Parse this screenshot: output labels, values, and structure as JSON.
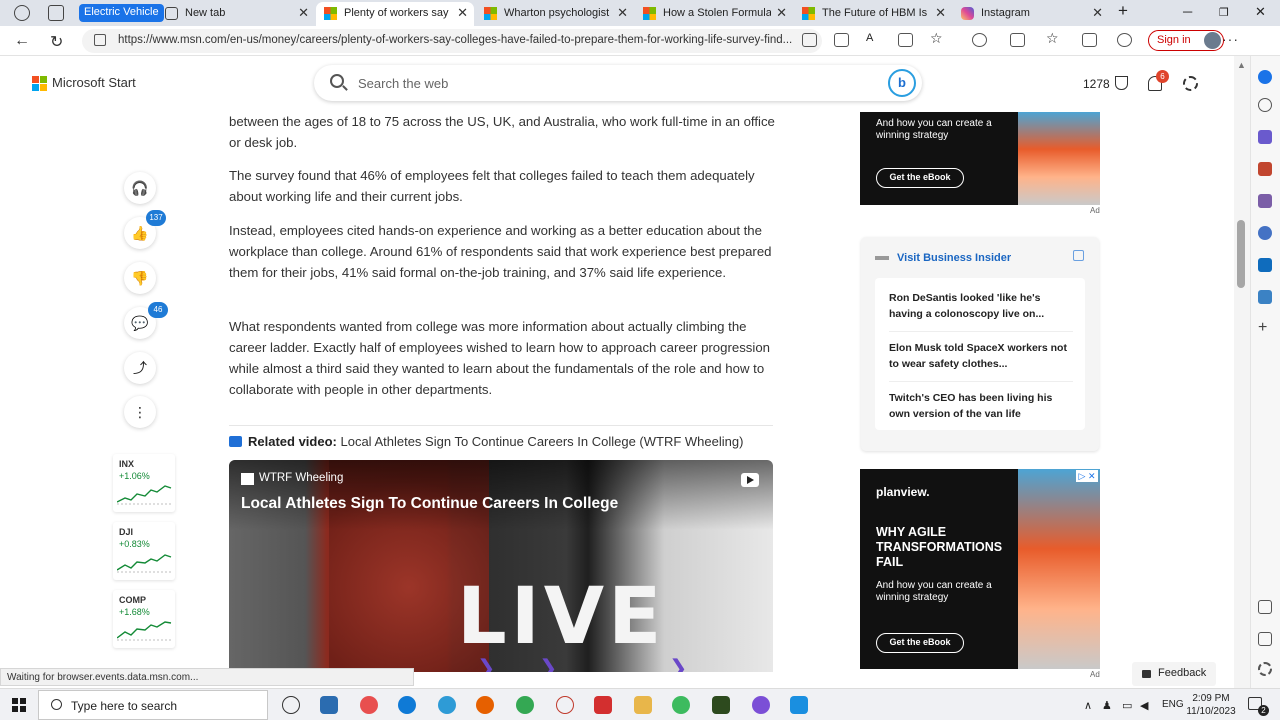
{
  "browser": {
    "tab_group_label": "Electric Vehicle",
    "tabs": [
      {
        "title": "New tab",
        "favicon": "newtab",
        "active": false
      },
      {
        "title": "Plenty of workers say coll",
        "favicon": "msn",
        "active": true
      },
      {
        "title": "Wharton psychologist on",
        "favicon": "msn",
        "active": false
      },
      {
        "title": "How a Stolen Formula Le",
        "favicon": "msn",
        "active": false
      },
      {
        "title": "The Future of HBM Is Lig",
        "favicon": "msn",
        "active": false
      },
      {
        "title": "Instagram",
        "favicon": "instagram",
        "active": false
      }
    ],
    "new_tab_symbol": "+",
    "url": "https://www.msn.com/en-us/money/careers/plenty-of-workers-say-colleges-have-failed-to-prepare-them-for-working-life-survey-find...",
    "sign_in_label": "Sign in",
    "status_text": "Waiting for browser.events.data.msn.com..."
  },
  "msn": {
    "brand": "Microsoft Start",
    "search_placeholder": "Search the web",
    "points": "1278",
    "notification_count": "6"
  },
  "engagement": {
    "like_count": "137",
    "comment_count": "46"
  },
  "stocks": [
    {
      "symbol": "INX",
      "change": "+1.06%"
    },
    {
      "symbol": "DJI",
      "change": "+0.83%"
    },
    {
      "symbol": "COMP",
      "change": "+1.68%"
    }
  ],
  "article": {
    "paragraphs": [
      "between the ages of 18 to 75 across the US, UK, and Australia, who work full-time in an office or desk job.",
      "The survey found that 46% of employees felt that colleges failed to teach them adequately about working life and their current jobs.",
      "Instead, employees cited hands-on experience and working as a better education about the workplace than college. Around 61% of respondents said that work experience best prepared them for their jobs, 41% said formal on-the-job training, and 37% said life experience.",
      "What respondents wanted from college was more information about actually climbing the career ladder. Exactly half of employees wished to learn how to approach career progression while almost a third said they wanted to learn about the fundamentals of the role and how to collaborate with people in other departments."
    ],
    "related_label": "Related video:",
    "related_title": "Local Athletes Sign To Continue Careers In College (WTRF Wheeling)",
    "video": {
      "source": "WTRF Wheeling",
      "title": "Local Athletes Sign To Continue Careers In College",
      "overlay_text": "LIVE"
    }
  },
  "ads": {
    "top": {
      "subtext": "And how you can create a winning strategy",
      "cta": "Get the eBook",
      "label": "Ad"
    },
    "bottom": {
      "brand": "planview.",
      "headline": "WHY AGILE TRANSFORMATIONS FAIL",
      "subtext": "And how you can create a winning strategy",
      "cta": "Get the eBook",
      "label": "Ad",
      "choices": "▷ ✕"
    }
  },
  "business_insider": {
    "title": "Visit Business Insider",
    "items": [
      "Ron DeSantis looked 'like he's having a colonoscopy live on...",
      "Elon Musk told SpaceX workers not to wear safety clothes...",
      "Twitch's CEO has been living his own version of the van life"
    ]
  },
  "feedback_label": "Feedback",
  "taskbar": {
    "search_placeholder": "Type here to search",
    "language": "ENG",
    "time": "2:09 PM",
    "date": "11/10/2023",
    "notification_count": "2"
  }
}
